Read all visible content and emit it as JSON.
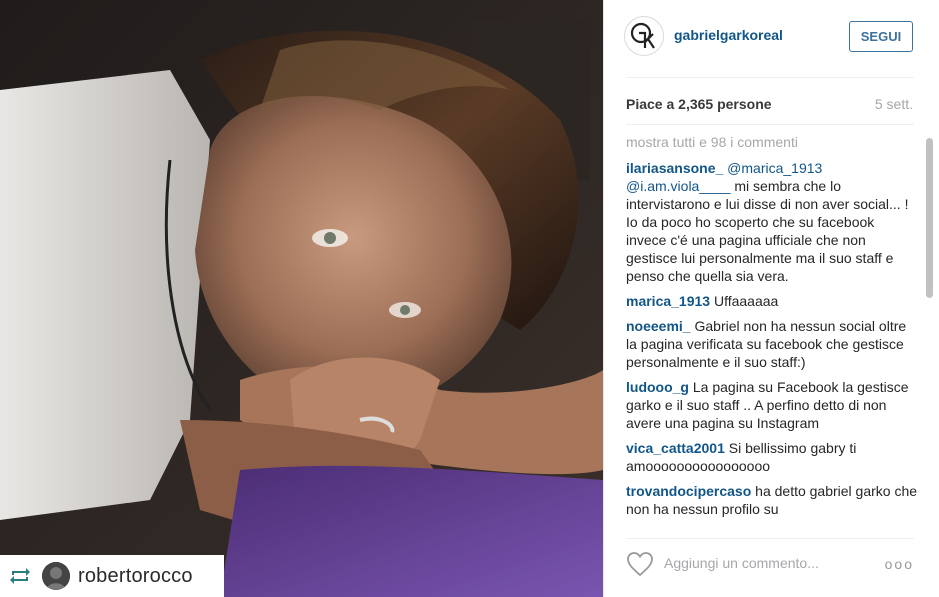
{
  "header": {
    "username": "gabrielgarkoreal",
    "follow_label": "SEGUI"
  },
  "stats": {
    "likes": "Piace a 2,365 persone",
    "time": "5 sett."
  },
  "comments": {
    "view_all": "mostra tutti e 98 i commenti",
    "items": [
      {
        "user": "ilariasansone_",
        "mentions": "@marica_1913 @i.am.viola____",
        "text": " mi sembra che lo intervistarono e lui disse di non aver social... ! Io da poco ho scoperto che su facebook invece c'é una pagina ufficiale che non gestisce lui personalmente ma il suo staff e penso che quella sia vera."
      },
      {
        "user": "marica_1913",
        "mentions": "",
        "text": " Uffaaaaaa"
      },
      {
        "user": "noeeemi_",
        "mentions": "",
        "text": " Gabriel non ha nessun social oltre la pagina verificata su facebook che gestisce personalmente e il suo staff:)"
      },
      {
        "user": "ludooo_g",
        "mentions": "",
        "text": " La pagina su Facebook la gestisce garko e il suo staff .. A perfino detto di non avere una pagina su Instagram"
      },
      {
        "user": "vica_catta2001",
        "mentions": "",
        "text": " Si bellissimo gabry ti amoooooooooooooooo"
      },
      {
        "user": "trovandocipercaso",
        "mentions": "",
        "text": " ha detto gabriel garko che non ha nessun profilo su"
      }
    ]
  },
  "footer": {
    "comment_placeholder": "Aggiungi un commento...",
    "more_label": "ooo"
  },
  "repost": {
    "username": "robertorocco"
  },
  "colors": {
    "link_blue": "#125688",
    "muted_gray": "#a5a7aa"
  },
  "icons": [
    "heart-icon",
    "repost-icon",
    "more-options-icon",
    "account-logo"
  ]
}
